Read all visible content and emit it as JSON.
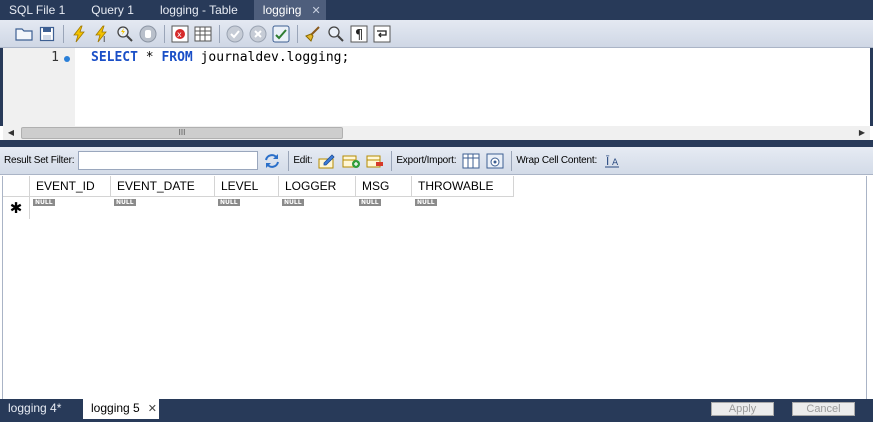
{
  "tabs": [
    {
      "label": "SQL File 1",
      "active": false
    },
    {
      "label": "Query 1",
      "active": false
    },
    {
      "label": "logging - Table",
      "active": false
    },
    {
      "label": "logging",
      "active": true
    }
  ],
  "editor": {
    "line_number": "1",
    "code": {
      "kw1": "SELECT",
      "mid": " * ",
      "kw2": "FROM",
      "rest": " journaldev.logging;"
    }
  },
  "scrollbar": {
    "thumb_grip": "III",
    "left_arrow": "◀",
    "right_arrow": "▶"
  },
  "result_toolbar": {
    "filter_label": "Result Set Filter:",
    "filter_value": "",
    "edit_label": "Edit:",
    "export_label": "Export/Import:",
    "wrap_label": "Wrap Cell Content:"
  },
  "grid": {
    "columns": [
      "EVENT_ID",
      "EVENT_DATE",
      "LEVEL",
      "LOGGER",
      "MSG",
      "THROWABLE"
    ],
    "new_row_marker": "✱",
    "null_label": "NULL"
  },
  "bottom": {
    "tabs": [
      {
        "label": "logging 4*",
        "active": false
      },
      {
        "label": "logging 5",
        "active": true
      }
    ],
    "close_glyph": "✕",
    "apply_label": "Apply",
    "cancel_label": "Cancel"
  },
  "icons": {
    "tab_close": "✕"
  }
}
